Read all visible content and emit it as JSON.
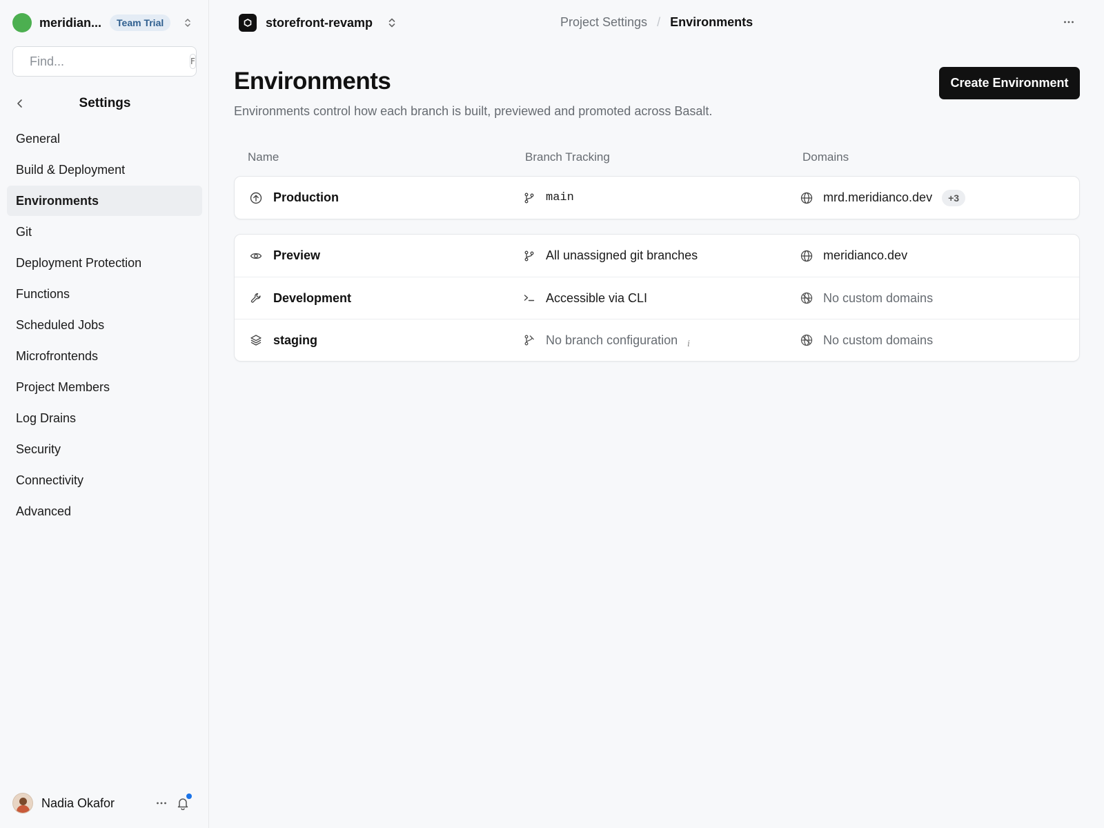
{
  "sidebar": {
    "team": {
      "name": "meridian...",
      "badge": "Team Trial",
      "avatar_color": "#4caf50"
    },
    "search": {
      "placeholder": "Find...",
      "shortcut": "F"
    },
    "settings_title": "Settings",
    "items": [
      {
        "label": "General"
      },
      {
        "label": "Build & Deployment"
      },
      {
        "label": "Environments",
        "active": true
      },
      {
        "label": "Git"
      },
      {
        "label": "Deployment Protection"
      },
      {
        "label": "Functions"
      },
      {
        "label": "Scheduled Jobs"
      },
      {
        "label": "Microfrontends"
      },
      {
        "label": "Project Members"
      },
      {
        "label": "Log Drains"
      },
      {
        "label": "Security"
      },
      {
        "label": "Connectivity"
      },
      {
        "label": "Advanced"
      }
    ],
    "user": {
      "name": "Nadia Okafor"
    }
  },
  "topbar": {
    "project_name": "storefront-revamp",
    "breadcrumb": [
      "Project Settings",
      "Environments"
    ]
  },
  "page": {
    "title": "Environments",
    "subtitle": "Environments control how each branch is built, previewed and promoted across Basalt.",
    "create_button": "Create Environment"
  },
  "table": {
    "columns": [
      "Name",
      "Branch Tracking",
      "Domains"
    ],
    "production": {
      "name": "Production",
      "name_icon": "arrow-up-circle-icon",
      "branch": "main",
      "branch_icon": "git-branch-icon",
      "domain": "mrd.meridianco.dev",
      "domain_icon": "globe-icon",
      "extra_domains": "+3"
    },
    "rows": [
      {
        "name": "Preview",
        "name_icon": "eye-icon",
        "branch": "All unassigned git branches",
        "branch_icon": "git-branch-icon",
        "domain": "meridianco.dev",
        "domain_icon": "globe-icon"
      },
      {
        "name": "Development",
        "name_icon": "wrench-icon",
        "branch": "Accessible via CLI",
        "branch_icon": "terminal-icon",
        "domain": "No custom domains",
        "domain_icon": "globe-off-icon"
      },
      {
        "name": "staging",
        "name_icon": "layers-icon",
        "branch": "No branch configuration",
        "branch_icon": "git-branch-off-icon",
        "branch_info": "i",
        "domain": "No custom domains",
        "domain_icon": "globe-off-icon"
      }
    ]
  },
  "colors": {
    "accent_button": "#111111",
    "notification_dot": "#1a73e8"
  }
}
